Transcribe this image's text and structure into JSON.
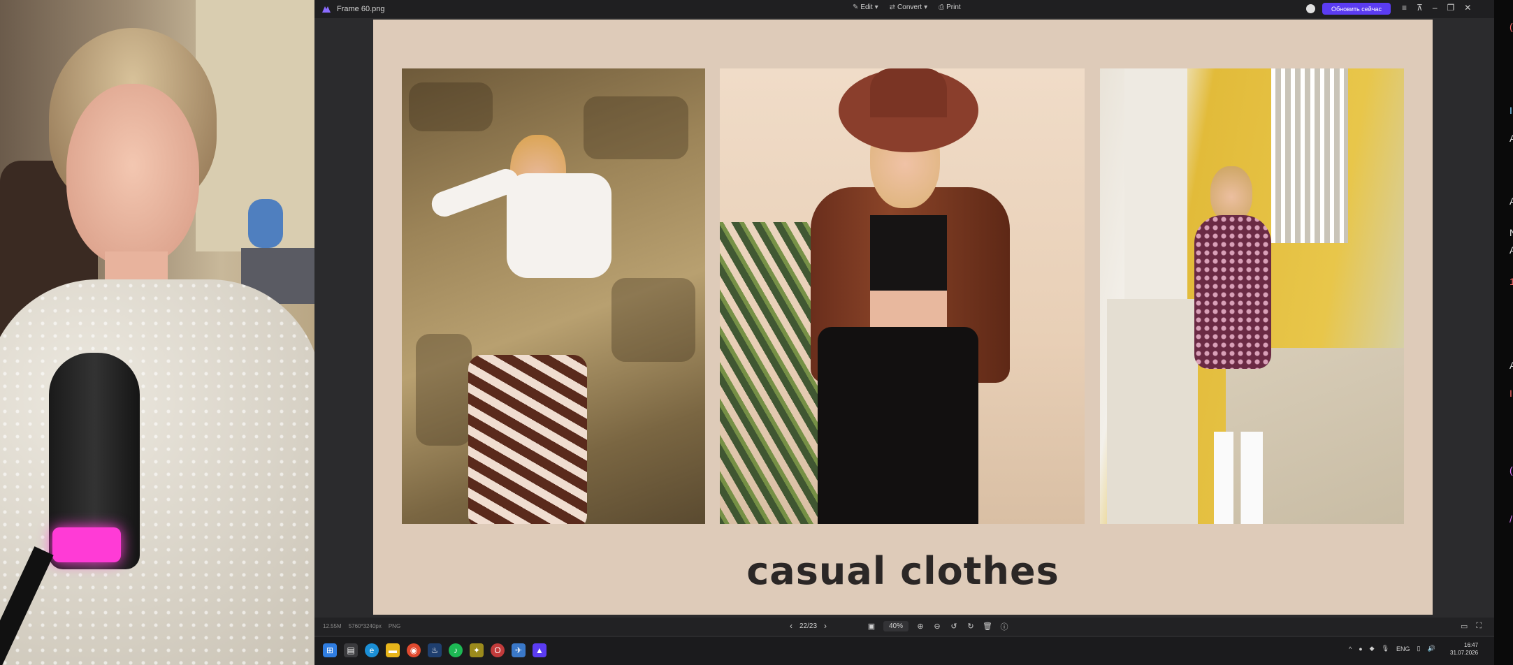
{
  "titlebar": {
    "filename": "Frame 60.png",
    "menu": [
      {
        "label": "Edit",
        "icon": "edit-icon"
      },
      {
        "label": "Convert",
        "icon": "convert-icon"
      },
      {
        "label": "Print",
        "icon": "print-icon"
      }
    ],
    "upgrade_label": "Обновить сейчас"
  },
  "slide": {
    "caption": "casual clothes",
    "background": "#decbb9"
  },
  "bottom_bar": {
    "meta": [
      "12.55M",
      "5760*3240px",
      "PNG"
    ],
    "page_indicator": "22/23",
    "zoom": "40%"
  },
  "taskbar": {
    "tray_lang": "ENG",
    "time": "16:47",
    "date": "31.07.2026"
  },
  "chat_strip": [
    "(",
    "I",
    "A",
    "A",
    "N",
    "A",
    "1",
    "A",
    "I",
    "(",
    "/"
  ],
  "colors": {
    "upgrade_button": "#5b3cf2",
    "mic_ring": "#ff3bd6"
  }
}
